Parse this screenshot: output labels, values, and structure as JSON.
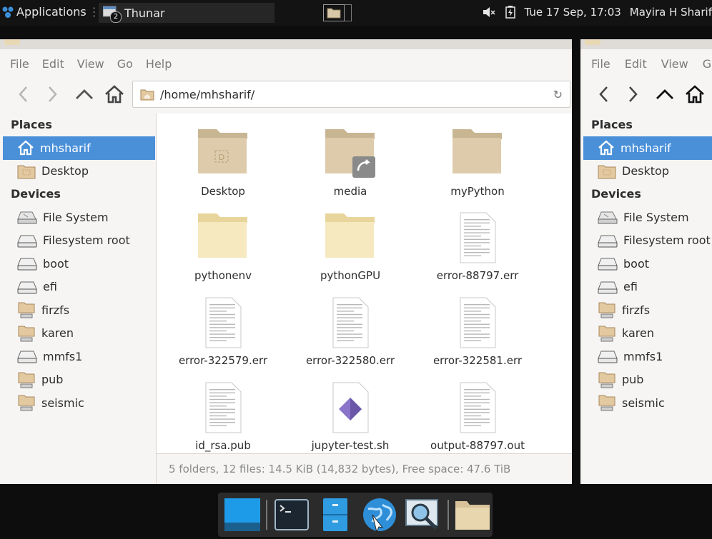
{
  "top_panel": {
    "applications_label": "Applications",
    "task_label": "Thunar",
    "task_badge": "2",
    "datetime": "Tue 17 Sep, 17:03",
    "user": "Mayira H Sharif"
  },
  "window": {
    "menu": [
      "File",
      "Edit",
      "View",
      "Go",
      "Help"
    ],
    "path": "/home/mhsharif/",
    "places_header": "Places",
    "devices_header": "Devices",
    "places": [
      {
        "label": "mhsharif",
        "icon": "home-icon",
        "selected": true
      },
      {
        "label": "Desktop",
        "icon": "desktop-folder-icon",
        "selected": false
      }
    ],
    "devices": [
      {
        "label": "File System",
        "icon": "filesystem-drive-icon"
      },
      {
        "label": "Filesystem root",
        "icon": "drive-icon"
      },
      {
        "label": "boot",
        "icon": "drive-icon"
      },
      {
        "label": "efi",
        "icon": "drive-icon"
      },
      {
        "label": "firzfs",
        "icon": "network-folder-icon"
      },
      {
        "label": "karen",
        "icon": "network-folder-icon"
      },
      {
        "label": "mmfs1",
        "icon": "drive-icon"
      },
      {
        "label": "pub",
        "icon": "network-folder-icon"
      },
      {
        "label": "seismic",
        "icon": "network-folder-icon"
      }
    ],
    "files": [
      {
        "name": "Desktop",
        "type": "folder-desktop"
      },
      {
        "name": "media",
        "type": "folder-link"
      },
      {
        "name": "myPython",
        "type": "folder"
      },
      {
        "name": "pythonenv",
        "type": "folder-light"
      },
      {
        "name": "pythonGPU",
        "type": "folder-light"
      },
      {
        "name": "error-88797.err",
        "type": "text"
      },
      {
        "name": "error-322579.err",
        "type": "text"
      },
      {
        "name": "error-322580.err",
        "type": "text"
      },
      {
        "name": "error-322581.err",
        "type": "text"
      },
      {
        "name": "id_rsa.pub",
        "type": "text"
      },
      {
        "name": "jupyter-test.sh",
        "type": "script"
      },
      {
        "name": "output-88797.out",
        "type": "text"
      }
    ],
    "status": "5 folders, 12 files: 14.5 KiB (14,832 bytes), Free space: 47.6 TiB"
  },
  "window2": {
    "menu": [
      "File",
      "Edit",
      "View",
      "G"
    ],
    "places_header": "Places",
    "devices_header": "Devices",
    "places": [
      "mhsharif",
      "Desktop"
    ],
    "devices": [
      "File System",
      "Filesystem root",
      "boot",
      "efi",
      "firzfs",
      "karen",
      "mmfs1",
      "pub",
      "seismic"
    ]
  },
  "dock": [
    "desktop-icon",
    "terminal-icon",
    "file-cabinet-icon",
    "web-browser-icon",
    "search-icon",
    "folder-icon"
  ],
  "colors": {
    "selection": "#4a90d9",
    "folder": "#d8c9a9",
    "folder_light": "#f3e6bc",
    "panel": "#131313"
  }
}
